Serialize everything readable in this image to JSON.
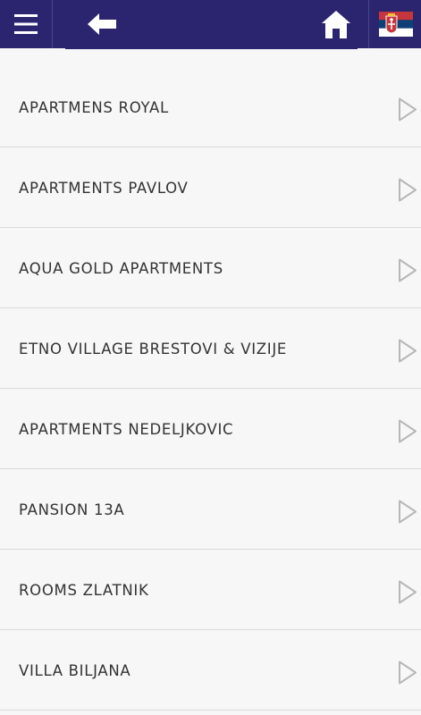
{
  "header": {
    "menu_icon": "hamburger-menu-icon",
    "back_icon": "arrow-left-icon",
    "home_icon": "home-icon",
    "language_icon": "serbia-flag-icon",
    "colors": {
      "bar": "#2b2570",
      "icon": "#ffffff",
      "flag_red": "#c6363c",
      "flag_blue": "#0c4076",
      "flag_white": "#ffffff"
    }
  },
  "list": {
    "items": [
      {
        "label": "APARTMENS ROYAL"
      },
      {
        "label": "APARTMENTS PAVLOV"
      },
      {
        "label": "AQUA GOLD APARTMENTS"
      },
      {
        "label": "ETNO VILLAGE BRESTOVI & VIZIJE"
      },
      {
        "label": "APARTMENTS NEDELJKOVIC"
      },
      {
        "label": "PANSION 13A"
      },
      {
        "label": "ROOMS ZLATNIK"
      },
      {
        "label": "VILLA BILJANA"
      }
    ],
    "chevron_icon": "chevron-right-icon"
  }
}
